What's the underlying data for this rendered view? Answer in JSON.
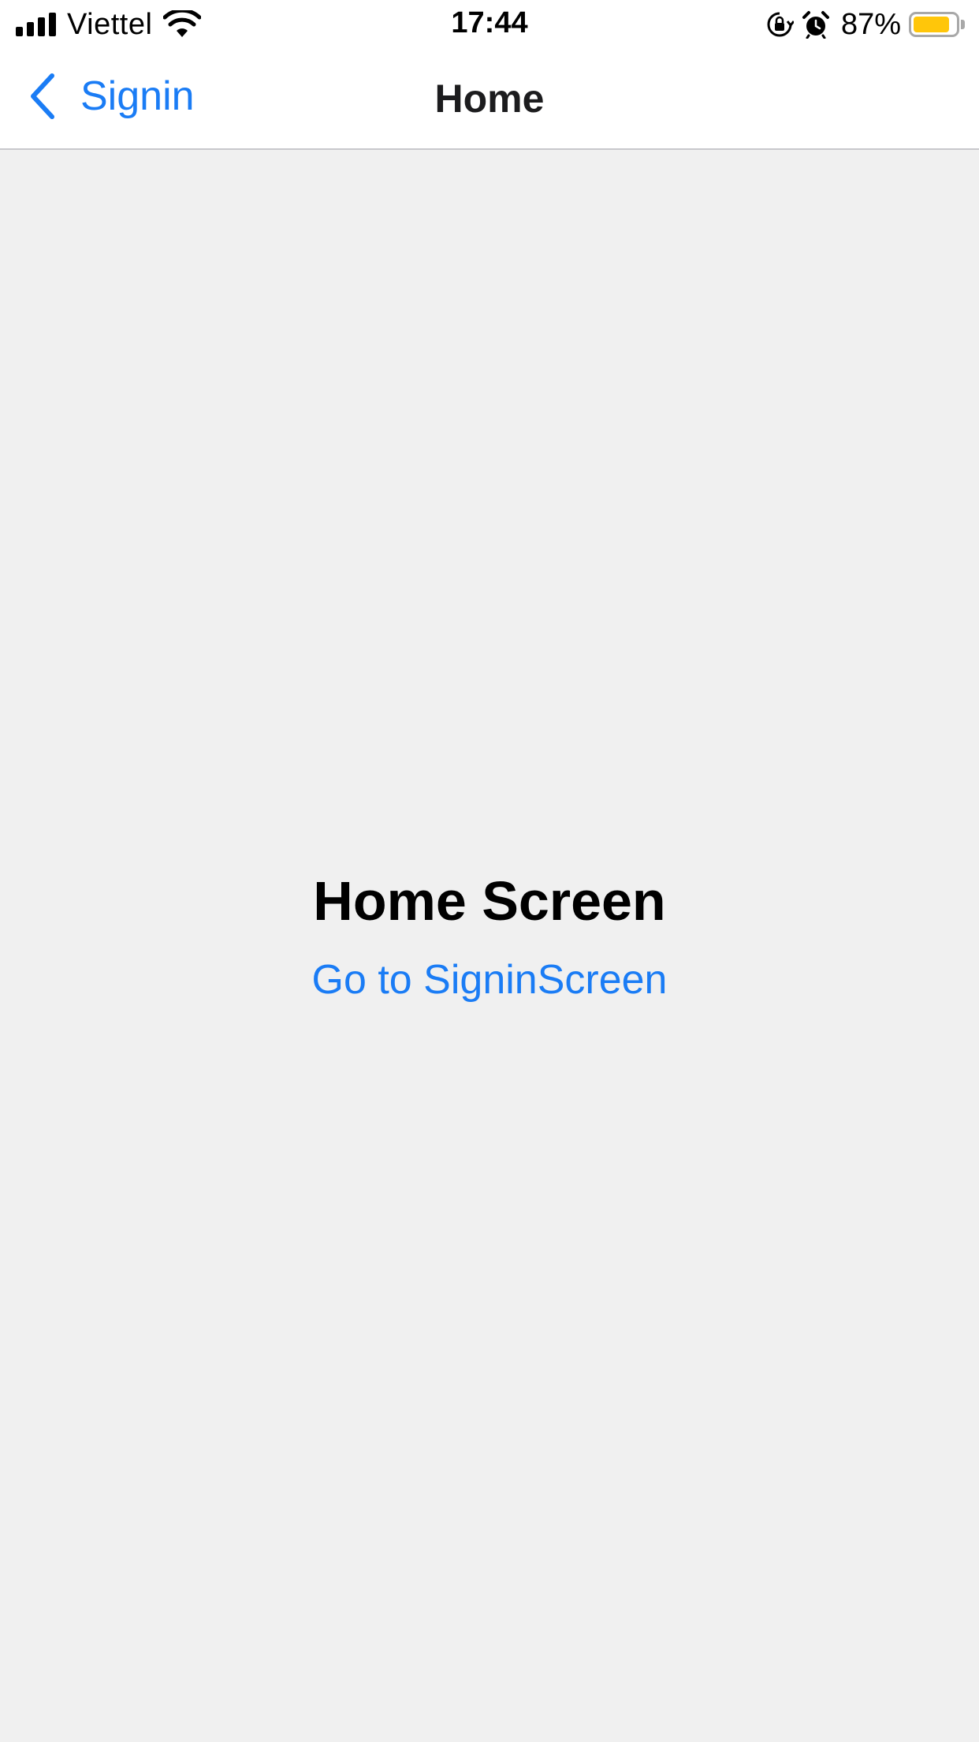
{
  "status_bar": {
    "carrier": "Viettel",
    "time": "17:44",
    "battery_percent": "87%",
    "battery_level": 0.87,
    "icons": [
      "signal-icon",
      "wifi-icon",
      "rotation-lock-icon",
      "alarm-icon",
      "battery-icon"
    ]
  },
  "nav": {
    "back_label": "Signin",
    "title": "Home"
  },
  "main": {
    "heading": "Home Screen",
    "link_label": "Go to SigninScreen"
  },
  "colors": {
    "accent": "#1a7cf5",
    "background": "#f0f0f0",
    "bar_background": "#ffffff",
    "battery": "#ffc60a"
  }
}
